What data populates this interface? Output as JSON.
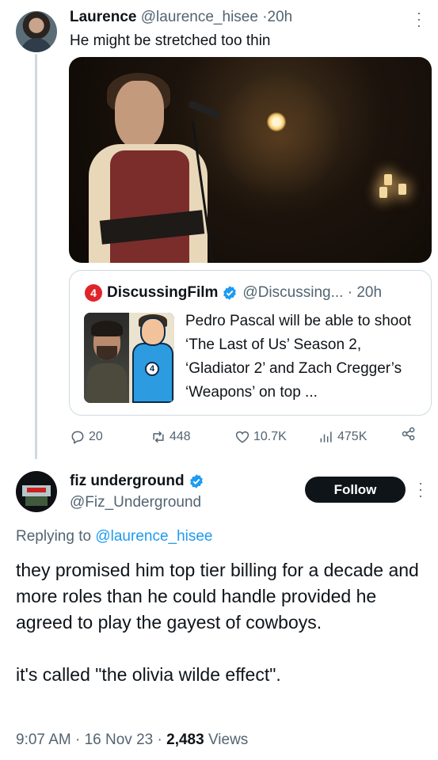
{
  "tweet1": {
    "display_name": "Laurence",
    "handle": "@laurence_hisee",
    "separator": "·",
    "time": "20h",
    "text": "He might be stretched too thin",
    "quote": {
      "logo_glyph": "4",
      "display_name": "DiscussingFilm",
      "handle": "@Discussing...",
      "time": "20h",
      "text": "Pedro Pascal will be able to shoot ‘The Last of Us’ Season 2, ‘Gladiator 2’ and Zach Cregger’s ‘Weapons’ on top ..."
    },
    "stats": {
      "replies": "20",
      "reposts": "448",
      "likes": "10.7K",
      "views": "475K"
    }
  },
  "tweet2": {
    "display_name": "fiz underground",
    "handle": "@Fiz_Underground",
    "follow_label": "Follow",
    "replying_prefix": "Replying to",
    "replying_handle": "@laurence_hisee",
    "paragraph1": "they promised him top tier billing for a decade and more roles than he could handle provided he  agreed to play the gayest of cowboys.",
    "paragraph2": "it's called \"the olivia wilde effect\".",
    "time": "9:07 AM",
    "date": "16 Nov 23",
    "views_count": "2,483",
    "views_label": "Views"
  },
  "colors": {
    "verified": "#1d9bf0",
    "link": "#1d9bf0",
    "muted": "#536471",
    "text": "#0f1419",
    "logo_red": "#e0242a"
  },
  "icons": [
    "more-icon",
    "verified-icon",
    "reply-icon",
    "repost-icon",
    "like-icon",
    "views-icon",
    "share-icon"
  ]
}
